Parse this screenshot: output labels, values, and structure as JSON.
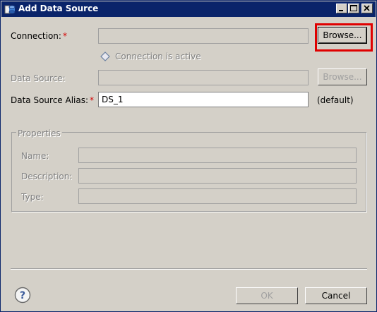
{
  "window": {
    "title": "Add Data Source"
  },
  "form": {
    "connection_label": "Connection:",
    "connection_value": "",
    "browse_label": "Browse...",
    "connection_status": "Connection is active",
    "datasource_label": "Data Source:",
    "datasource_value": "",
    "browse2_label": "Browse...",
    "alias_label": "Data Source Alias:",
    "alias_value": "DS_1",
    "alias_default": "(default)",
    "required_marker": "*"
  },
  "properties": {
    "title": "Properties",
    "name_label": "Name:",
    "description_label": "Description:",
    "type_label": "Type:",
    "name_value": "",
    "description_value": "",
    "type_value": ""
  },
  "footer": {
    "ok_label": "OK",
    "cancel_label": "Cancel"
  },
  "icons": [
    "app-icon",
    "minimize-icon",
    "maximize-icon",
    "close-icon",
    "diamond-icon",
    "help-icon"
  ],
  "colors": {
    "titlebar": "#0a246a",
    "dialog": "#d4d0c8",
    "required": "#d40000",
    "highlight": "#e00000"
  }
}
